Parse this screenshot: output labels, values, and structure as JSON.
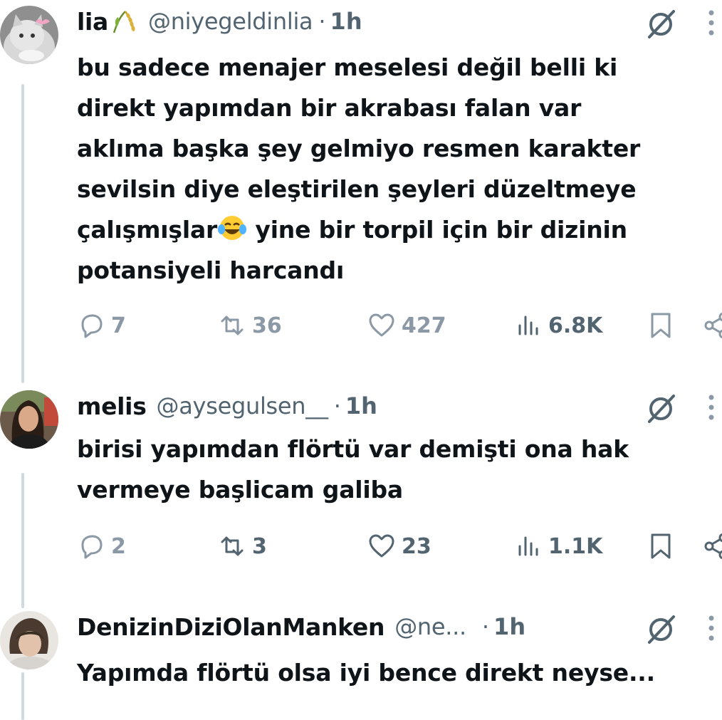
{
  "tweets": [
    {
      "name": "lia",
      "handle": "@niyegeldinlia",
      "dot": "·",
      "time": "1h",
      "lines": [
        "bu sadece menajer meselesi değil belli ki",
        "direkt yapımdan bir akrabası falan var",
        "aklıma başka şey gelmiyo resmen karakter",
        "sevilsin diye eleştirilen şeyleri düzeltmeye",
        "çalışmışlar",
        " yine bir torpil için bir dizinin",
        "potansiyeli harcandı"
      ],
      "replies": "7",
      "reposts": "36",
      "likes": "427",
      "views": "6.8K"
    },
    {
      "name": "melis",
      "handle": "@aysegulsen__",
      "dot": "·",
      "time": "1h",
      "lines": [
        "birisi yapımdan flörtü var demişti ona hak",
        "vermeye başlicam galiba"
      ],
      "replies": "2",
      "reposts": "3",
      "likes": "23",
      "views": "1.1K"
    },
    {
      "name": "DenizinDiziOlanManken",
      "handle": "@ne...",
      "dot": "·",
      "time": "1h",
      "lines": [
        "Yapımda flörtü olsa iyi bence direkt neyse..."
      ]
    }
  ],
  "icons": {
    "name_badge": "rice-leaf-icon",
    "emoji": "tears-of-joy-emoji",
    "grok": "grok-icon",
    "more": "more-vertical-icon",
    "reply": "reply-icon",
    "repost": "repost-icon",
    "like": "heart-icon",
    "views": "views-icon",
    "bookmark": "bookmark-icon",
    "share": "share-icon"
  },
  "colors": {
    "text": "#0f1419",
    "muted": "#536471",
    "icon_muted": "#8b98a5",
    "thread_line": "#cfd9de"
  }
}
